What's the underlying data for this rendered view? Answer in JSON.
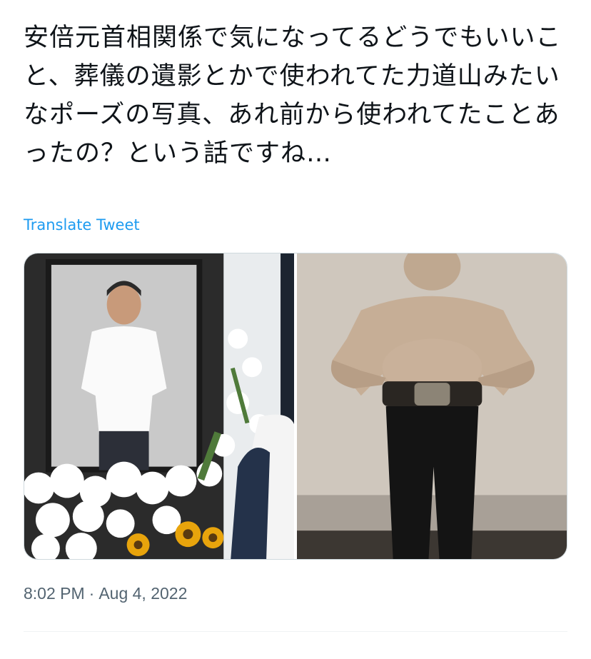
{
  "tweet": {
    "text": "安倍元首相関係で気になってるどうでもいいこと、葬儀の遺影とかで使われてた力道山みたいなポーズの写真、あれ前から使われてたことあったの？という話ですね…",
    "translate_label": "Translate Tweet",
    "time": "8:02 PM",
    "separator": "·",
    "date": "Aug 4, 2022"
  },
  "colors": {
    "link": "#1d9bf0",
    "muted": "#536471",
    "text": "#0f1419",
    "border": "#cfd9de"
  }
}
